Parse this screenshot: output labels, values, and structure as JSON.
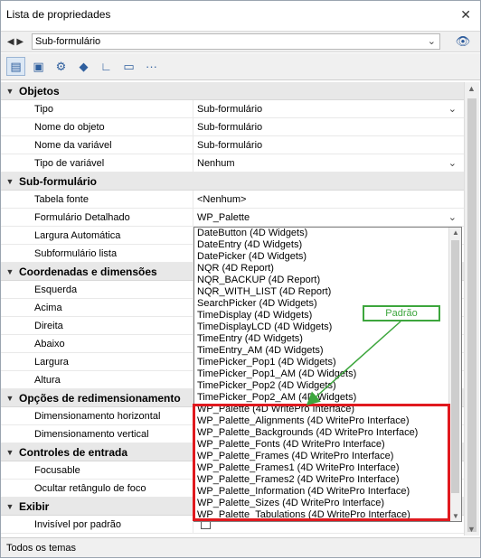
{
  "window": {
    "title": "Lista de propriedades",
    "close_glyph": "✕"
  },
  "objbar": {
    "nav_glyph": "◀ ▶",
    "selected_object": "Sub-formulário",
    "chevron": "⌄",
    "eye_glyph": "👁"
  },
  "toolbar": {
    "buttons": [
      {
        "name": "list-icon",
        "glyph": "▤"
      },
      {
        "name": "save-icon",
        "glyph": "▣"
      },
      {
        "name": "gear-icon",
        "glyph": "⚙"
      },
      {
        "name": "shapes-icon",
        "glyph": "◆"
      },
      {
        "name": "chart-icon",
        "glyph": "∟"
      },
      {
        "name": "monitor-icon",
        "glyph": "▭"
      },
      {
        "name": "more-icon",
        "glyph": "···"
      }
    ]
  },
  "sections": [
    {
      "title": "Objetos",
      "rows": [
        {
          "label": "Tipo",
          "value": "Sub-formulário",
          "dropdown": true
        },
        {
          "label": "Nome do objeto",
          "value": "Sub-formulário"
        },
        {
          "label": "Nome da variável",
          "value": "Sub-formulário"
        },
        {
          "label": "Tipo de variável",
          "value": "Nenhum",
          "dropdown": true
        }
      ]
    },
    {
      "title": "Sub-formulário",
      "rows": [
        {
          "label": "Tabela fonte",
          "value": "<Nenhum>"
        },
        {
          "label": "Formulário Detalhado",
          "value": "WP_Palette",
          "dropdown": true
        },
        {
          "label": "Largura Automática",
          "value": ""
        },
        {
          "label": "Subformulário lista",
          "value": ""
        }
      ]
    },
    {
      "title": "Coordenadas e dimensões",
      "rows": [
        {
          "label": "Esquerda",
          "value": ""
        },
        {
          "label": "Acima",
          "value": ""
        },
        {
          "label": "Direita",
          "value": ""
        },
        {
          "label": "Abaixo",
          "value": ""
        },
        {
          "label": "Largura",
          "value": ""
        },
        {
          "label": "Altura",
          "value": ""
        }
      ]
    },
    {
      "title": "Opções de redimensionamento",
      "rows": [
        {
          "label": "Dimensionamento horizontal",
          "value": ""
        },
        {
          "label": "Dimensionamento vertical",
          "value": ""
        }
      ]
    },
    {
      "title": "Controles de entrada",
      "rows": [
        {
          "label": "Focusable",
          "value": ""
        },
        {
          "label": "Ocultar retângulo de foco",
          "value": ""
        }
      ]
    },
    {
      "title": "Exibir",
      "rows": [
        {
          "label": "Invisível por padrão",
          "value": "",
          "checkbox": true
        }
      ]
    }
  ],
  "dropdown": {
    "items": [
      "DateButton (4D Widgets)",
      "DateEntry (4D Widgets)",
      "DatePicker (4D Widgets)",
      "NQR (4D Report)",
      "NQR_BACKUP (4D Report)",
      "NQR_WITH_LIST (4D Report)",
      "SearchPicker (4D Widgets)",
      "TimeDisplay (4D Widgets)",
      "TimeDisplayLCD (4D Widgets)",
      "TimeEntry (4D Widgets)",
      "TimeEntry_AM (4D Widgets)",
      "TimePicker_Pop1 (4D Widgets)",
      "TimePicker_Pop1_AM (4D Widgets)",
      "TimePicker_Pop2 (4D Widgets)",
      "TimePicker_Pop2_AM (4D Widgets)",
      "WP_Palette (4D WritePro Interface)",
      "WP_Palette_Alignments (4D WritePro Interface)",
      "WP_Palette_Backgrounds (4D WritePro Interface)",
      "WP_Palette_Fonts (4D WritePro Interface)",
      "WP_Palette_Frames (4D WritePro Interface)",
      "WP_Palette_Frames1 (4D WritePro Interface)",
      "WP_Palette_Frames2 (4D WritePro Interface)",
      "WP_Palette_Information (4D WritePro Interface)",
      "WP_Palette_Sizes (4D WritePro Interface)",
      "WP_Palette_Tabulations (4D WritePro Interface)"
    ]
  },
  "annotation": {
    "callout_text": "Padrão",
    "highlight_color": "#e0191e",
    "callout_color": "#3da63d"
  },
  "statusbar": {
    "text": "Todos os temas"
  }
}
